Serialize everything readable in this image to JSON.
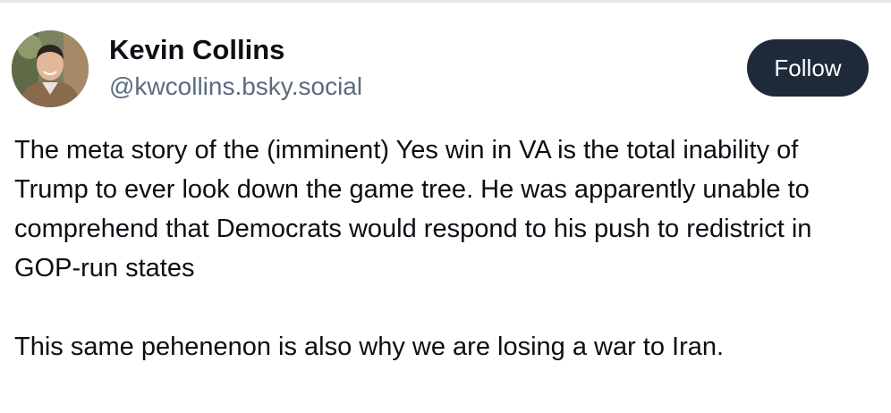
{
  "post": {
    "author": {
      "display_name": "Kevin Collins",
      "handle": "@kwcollins.bsky.social",
      "avatar_icon": "profile-photo"
    },
    "follow_label": "Follow",
    "paragraphs": [
      "The meta story of the (imminent) Yes win in VA is the total inability of Trump to ever look down the game tree. He was apparently unable to comprehend that Democrats would respond to his push to redistrict in GOP-run states",
      "This same pehenenon is also why we are losing a war to Iran."
    ]
  },
  "colors": {
    "follow_button_bg": "#1e2a3a",
    "handle_text": "#5b6b7e",
    "body_text": "#0b0f14"
  }
}
